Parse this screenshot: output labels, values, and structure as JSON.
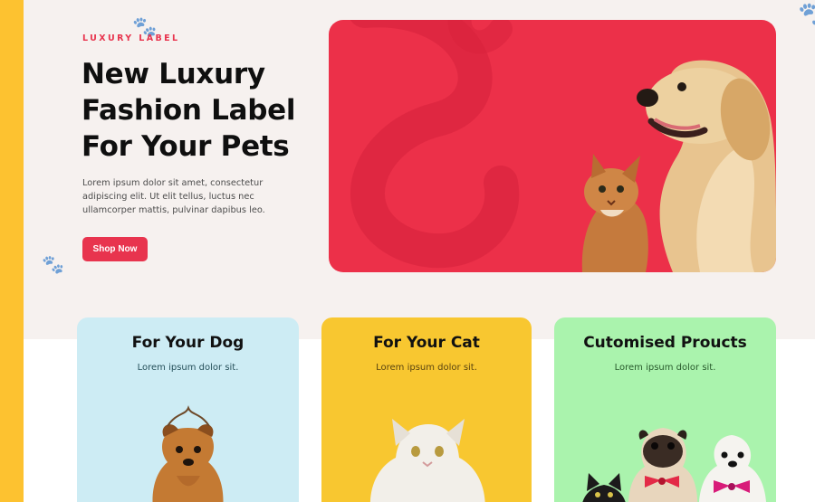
{
  "hero": {
    "eyebrow": "LUXURY LABEL",
    "title": "New Luxury Fashion Label For Your Pets",
    "description": "Lorem ipsum dolor sit amet, consectetur adipiscing elit. Ut elit tellus, luctus nec ullamcorper mattis, pulvinar dapibus leo.",
    "cta_label": "Shop Now",
    "image_alt": "dog and cat on red background"
  },
  "cards": [
    {
      "title": "For Your Dog",
      "subtitle": "Lorem ipsum dolor sit."
    },
    {
      "title": "For Your Cat",
      "subtitle": "Lorem ipsum dolor sit."
    },
    {
      "title": "Cutomised Proucts",
      "subtitle": "Lorem ipsum dolor sit."
    }
  ],
  "colors": {
    "accent": "#e8344e",
    "side_strip": "#fdc230",
    "hero_background": "#f6f1ef",
    "dog_card": "#cdecf4",
    "cat_card": "#f8c730",
    "custom_card": "#aaf3ad"
  }
}
